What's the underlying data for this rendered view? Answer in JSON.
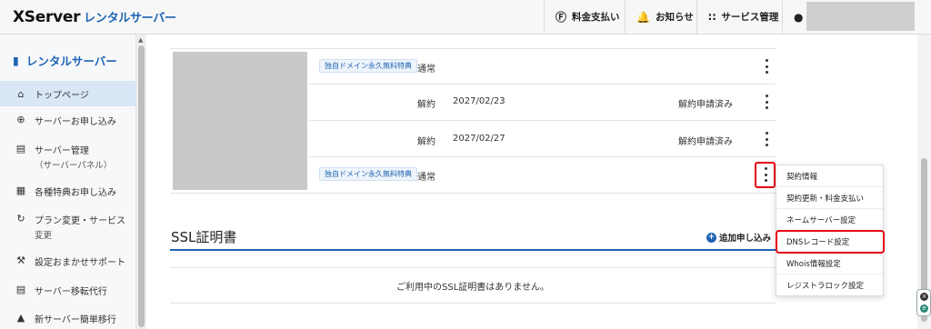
{
  "header": {
    "logo_main": "XServer",
    "logo_sub": "レンタルサーバー",
    "fee_label": "料金支払い",
    "news_label": "お知らせ",
    "service_label": "サービス管理"
  },
  "sidebar": {
    "title": "レンタルサーバー",
    "items": [
      {
        "label": "トップページ",
        "sub": ""
      },
      {
        "label": "サーバーお申し込み",
        "sub": ""
      },
      {
        "label": "サーバー管理",
        "sub": "（サーバーパネル）"
      },
      {
        "label": "各種特典お申し込み",
        "sub": ""
      },
      {
        "label": "プラン変更・サービス",
        "sub": "変更"
      },
      {
        "label": "設定おまかせサポート",
        "sub": ""
      },
      {
        "label": "サーバー移転代行",
        "sub": ""
      },
      {
        "label": "新サーバー簡単移行",
        "sub": ""
      }
    ]
  },
  "domains": {
    "rows": [
      {
        "badge": "独自ドメイン永久無料特典",
        "status": "通常",
        "date": "",
        "note": ""
      },
      {
        "badge": "",
        "status": "解約",
        "date": "2027/02/23",
        "note": "解約申請済み"
      },
      {
        "badge": "",
        "status": "解約",
        "date": "2027/02/27",
        "note": "解約申請済み"
      },
      {
        "badge": "独自ドメイン永久無料特典",
        "status": "通常",
        "date": "",
        "note": ""
      }
    ]
  },
  "ssl": {
    "title": "SSL証明書",
    "add_label": "追加申し込み",
    "empty_message": "ご利用中のSSL証明書はありません。"
  },
  "menu": {
    "items": [
      "契約情報",
      "契約更新・料金支払い",
      "ネームサーバー設定",
      "DNSレコード設定",
      "Whois情報設定",
      "レジストラロック設定"
    ]
  },
  "colors": {
    "accent": "#1e64b4",
    "highlight": "#e60012"
  }
}
